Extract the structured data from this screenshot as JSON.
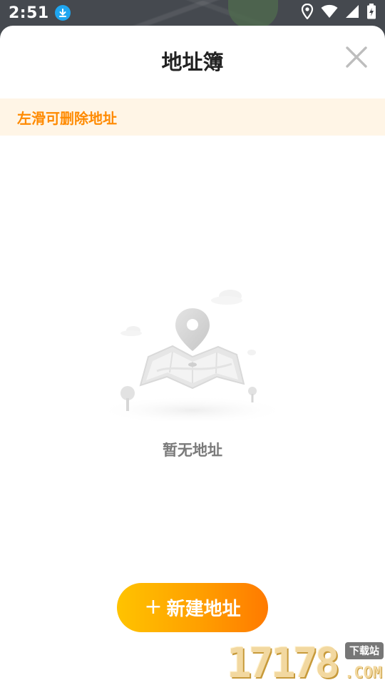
{
  "status_bar": {
    "time": "2:51",
    "icons": [
      "download-icon",
      "location-icon",
      "wifi-icon",
      "signal-icon",
      "battery-charging-icon"
    ]
  },
  "sheet": {
    "title": "地址簿",
    "close_icon": "close-icon"
  },
  "notice": {
    "text": "左滑可删除地址",
    "color": "#ff8a00",
    "background": "#fff5e6"
  },
  "empty_state": {
    "illustration": "map-pin-illustration",
    "text": "暂无地址"
  },
  "actions": {
    "new_address_plus": "+",
    "new_address_label": "新建地址",
    "gradient_start": "#ffc300",
    "gradient_end": "#ff7a00"
  },
  "watermark": {
    "digits": "17178",
    "badge": "下载站",
    "suffix": ".COM"
  }
}
